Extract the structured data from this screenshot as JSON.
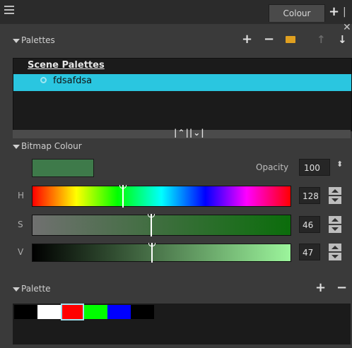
{
  "header": {
    "tab_label": "Colour"
  },
  "palettes_section": {
    "title": "Palettes",
    "list_heading": "Scene Palettes",
    "items": [
      {
        "label": "fdsafdsa",
        "selected": true
      }
    ],
    "toolbar_icons": [
      "add-icon",
      "remove-icon",
      "folder-icon",
      "move-up-icon",
      "move-down-icon"
    ]
  },
  "bitmap_colour": {
    "title": "Bitmap Colour",
    "current_colour": "#3e7a4a",
    "opacity_label": "Opacity",
    "opacity_value": "100",
    "channels": [
      {
        "label": "H",
        "value": "128"
      },
      {
        "label": "S",
        "value": "46"
      },
      {
        "label": "V",
        "value": "47"
      }
    ]
  },
  "palette_section": {
    "title": "Palette",
    "swatches": [
      "#000000",
      "#ffffff",
      "#ff0000",
      "#00ff00",
      "#0000ff",
      "#000000"
    ],
    "selected_swatch": 2
  },
  "colors": {
    "accent": "#2ac6e0"
  }
}
